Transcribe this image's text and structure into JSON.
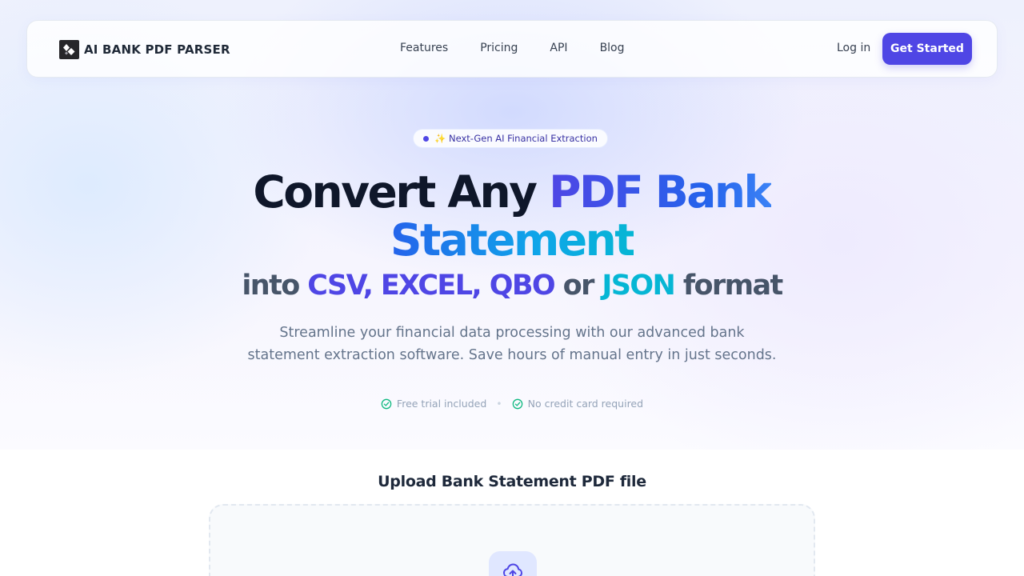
{
  "brand": {
    "name": "AI BANK PDF PARSER"
  },
  "nav": {
    "links": [
      "Features",
      "Pricing",
      "API",
      "Blog"
    ],
    "login": "Log in",
    "cta": "Get Started"
  },
  "hero": {
    "badge": "✨ Next-Gen AI Financial Extraction",
    "title_part1": "Convert Any ",
    "title_part2": "PDF Bank",
    "title_line2": "Statement",
    "format_into": "into ",
    "format_csv": "CSV, ",
    "format_excel": "EXCEL, ",
    "format_qbo": "QBO",
    "format_or": " or ",
    "format_json": "JSON",
    "format_suffix": " format",
    "subtitle_line1": "Streamline your financial data processing with our advanced bank",
    "subtitle_line2": "statement extraction software. Save hours of manual entry in just seconds.",
    "check1": "Free trial included",
    "separator": "•",
    "check2": "No credit card required"
  },
  "upload": {
    "title": "Upload Bank Statement PDF file"
  },
  "colors": {
    "primary": "#4f46e5",
    "cyan": "#06b6d4",
    "check_green": "#10b981"
  }
}
